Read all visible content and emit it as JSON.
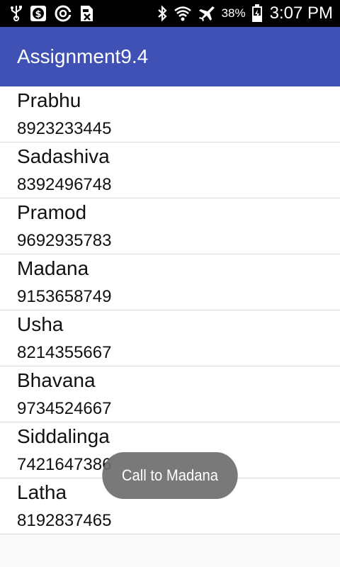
{
  "status_bar": {
    "battery": "38%",
    "time": "3:07 PM",
    "icons": [
      "usb-icon",
      "s-app-icon",
      "sync-icon",
      "screenshot-icon",
      "bluetooth-icon",
      "wifi-icon",
      "airplane-icon",
      "battery-icon"
    ]
  },
  "app_bar": {
    "title": "Assignment9.4"
  },
  "contacts": [
    {
      "name": "Prabhu",
      "phone": "8923233445"
    },
    {
      "name": "Sadashiva",
      "phone": "8392496748"
    },
    {
      "name": "Pramod",
      "phone": "9692935783"
    },
    {
      "name": "Madana",
      "phone": "9153658749"
    },
    {
      "name": "Usha",
      "phone": "8214355667"
    },
    {
      "name": "Bhavana",
      "phone": "9734524667"
    },
    {
      "name": "Siddalinga",
      "phone": "7421647386"
    },
    {
      "name": "Latha",
      "phone": "8192837465"
    }
  ],
  "toast": {
    "text": "Call to Madana"
  },
  "colors": {
    "app_bar": "#3f51b5",
    "status_bar": "#000000",
    "toast": "#6e6e6e"
  }
}
